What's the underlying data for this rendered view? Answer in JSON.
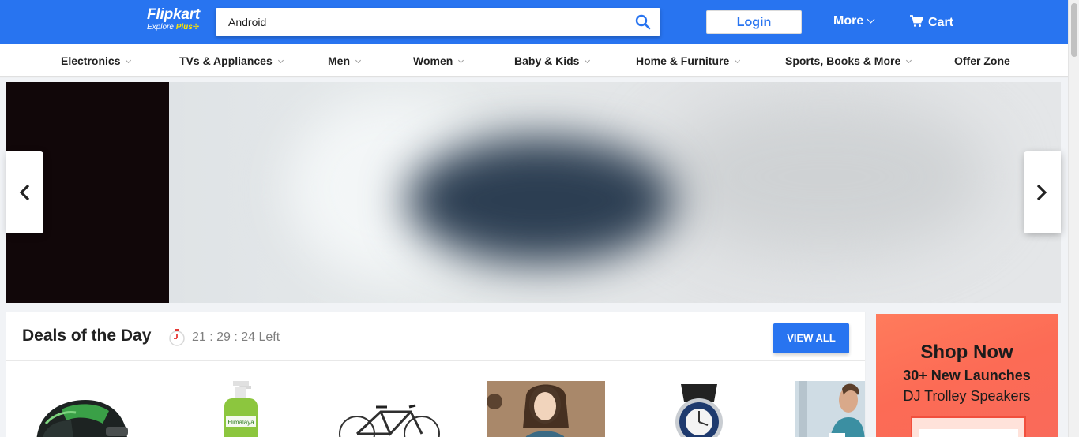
{
  "header": {
    "logo_text": "Flipkart",
    "logo_sub": "Explore",
    "logo_plus": "Plus",
    "search_value": "Android",
    "login_label": "Login",
    "more_label": "More",
    "cart_label": "Cart"
  },
  "categories": [
    {
      "label": "Electronics",
      "has_chevron": true
    },
    {
      "label": "TVs & Appliances",
      "has_chevron": true
    },
    {
      "label": "Men",
      "has_chevron": true
    },
    {
      "label": "Women",
      "has_chevron": true
    },
    {
      "label": "Baby & Kids",
      "has_chevron": true
    },
    {
      "label": "Home & Furniture",
      "has_chevron": true
    },
    {
      "label": "Sports, Books & More",
      "has_chevron": true
    },
    {
      "label": "Offer Zone",
      "has_chevron": false
    }
  ],
  "deals": {
    "title": "Deals of the Day",
    "timer": "21 : 29 : 24 Left",
    "view_all": "VIEW ALL",
    "products": [
      "helmet",
      "face-wash-bottle",
      "bicycle",
      "lingerie-model",
      "wrist-watch",
      "shirt-model"
    ]
  },
  "ad": {
    "headline": "Shop Now",
    "line2": "30+ New Launches",
    "line3": "DJ Trolley Speakers"
  },
  "colors": {
    "brand_blue": "#2874f0",
    "plus_yellow": "#ffe500",
    "ad_orange": "#fc6b55"
  }
}
